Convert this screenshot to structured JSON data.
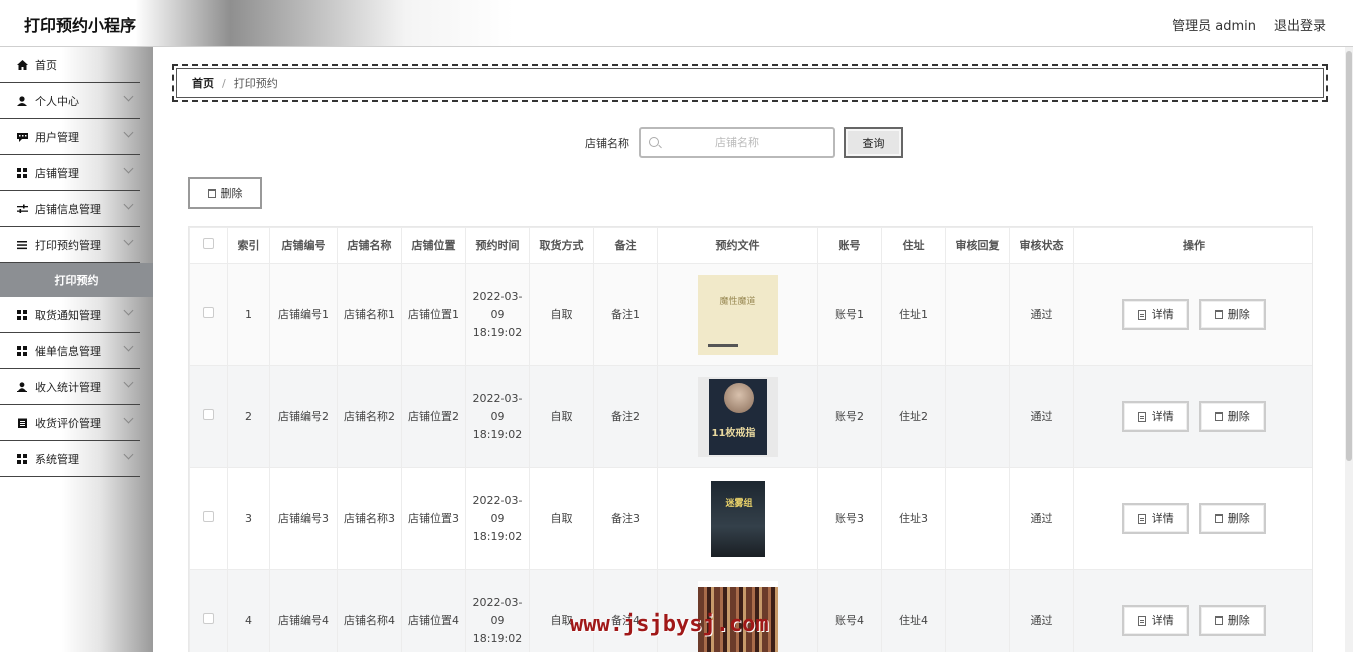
{
  "header": {
    "app_title": "打印预约小程序",
    "user_label": "管理员 admin",
    "logout_label": "退出登录"
  },
  "sidebar": {
    "items": [
      {
        "label": "首页",
        "icon": "home-icon",
        "has_children": false
      },
      {
        "label": "个人中心",
        "icon": "user-icon",
        "has_children": true
      },
      {
        "label": "用户管理",
        "icon": "message-icon",
        "has_children": true
      },
      {
        "label": "店铺管理",
        "icon": "grid-icon",
        "has_children": true
      },
      {
        "label": "店铺信息管理",
        "icon": "sliders-icon",
        "has_children": true
      },
      {
        "label": "打印预约管理",
        "icon": "list-icon",
        "has_children": true
      },
      {
        "label": "取货通知管理",
        "icon": "grid-icon",
        "has_children": true
      },
      {
        "label": "催单信息管理",
        "icon": "grid-icon",
        "has_children": true
      },
      {
        "label": "收入统计管理",
        "icon": "person-icon",
        "has_children": true
      },
      {
        "label": "收货评价管理",
        "icon": "clipboard-icon",
        "has_children": true
      },
      {
        "label": "系统管理",
        "icon": "grid-icon",
        "has_children": true
      }
    ],
    "active_submenu": "打印预约"
  },
  "breadcrumb": {
    "home": "首页",
    "separator": "/",
    "current": "打印预约"
  },
  "search": {
    "label": "店铺名称",
    "placeholder": "店铺名称",
    "value": "",
    "button_label": "查询"
  },
  "toolbar": {
    "delete_label": "删除"
  },
  "table": {
    "columns": [
      "索引",
      "店铺编号",
      "店铺名称",
      "店铺位置",
      "预约时间",
      "取货方式",
      "备注",
      "预约文件",
      "账号",
      "住址",
      "审核回复",
      "审核状态",
      "操作"
    ],
    "detail_label": "详情",
    "delete_label": "删除",
    "rows": [
      {
        "index": "1",
        "shop_no": "店铺编号1",
        "shop_name": "店铺名称1",
        "shop_loc": "店铺位置1",
        "time": "2022-03-09 18:19:02",
        "pickup": "自取",
        "note": "备注1",
        "cover_title": "魔性魔道",
        "account": "账号1",
        "address": "住址1",
        "reply": "",
        "status": "通过"
      },
      {
        "index": "2",
        "shop_no": "店铺编号2",
        "shop_name": "店铺名称2",
        "shop_loc": "店铺位置2",
        "time": "2022-03-09 18:19:02",
        "pickup": "自取",
        "note": "备注2",
        "cover_title": "11枚戒指",
        "account": "账号2",
        "address": "住址2",
        "reply": "",
        "status": "通过"
      },
      {
        "index": "3",
        "shop_no": "店铺编号3",
        "shop_name": "店铺名称3",
        "shop_loc": "店铺位置3",
        "time": "2022-03-09 18:19:02",
        "pickup": "自取",
        "note": "备注3",
        "cover_title": "迷雾组",
        "account": "账号3",
        "address": "住址3",
        "reply": "",
        "status": "通过"
      },
      {
        "index": "4",
        "shop_no": "店铺编号4",
        "shop_name": "店铺名称4",
        "shop_loc": "店铺位置4",
        "time": "2022-03-09 18:19:02",
        "pickup": "自取",
        "note": "备注4",
        "cover_title": "",
        "account": "账号4",
        "address": "住址4",
        "reply": "",
        "status": "通过"
      }
    ]
  },
  "watermark": "www.jsjbysj.com"
}
